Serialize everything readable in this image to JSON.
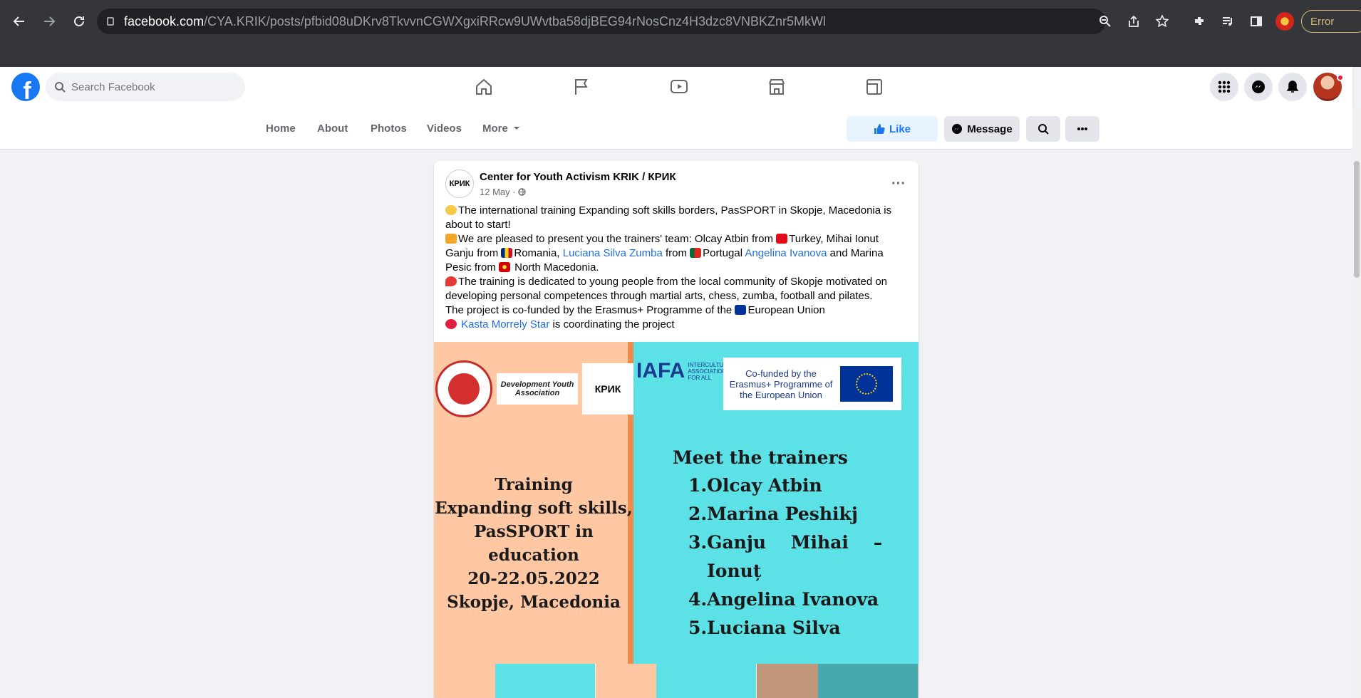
{
  "browser": {
    "url_host": "facebook.com",
    "url_path": "/CYA.KRIK/posts/pfbid08uDKrv8TkvvnCGWXgxiRRcw9UWvtba58djBEG94rNosCnz4H3dzc8VNBKZnr5MkWl",
    "error_label": "Error"
  },
  "header": {
    "logo_letter": "f",
    "search_placeholder": "Search Facebook"
  },
  "page_nav": {
    "tabs": [
      "Home",
      "About",
      "Photos",
      "Videos",
      "More"
    ],
    "like_label": "Like",
    "message_label": "Message"
  },
  "post": {
    "author": "Center for Youth Activism KRIK / КРИК",
    "avatar_text": "КРИК",
    "date": "12 May · ",
    "line1": "The international training Expanding soft skills borders, PasSPORT in Skopje, Macedonia is about to start!",
    "line2_a": "We are pleased to present you the trainers' team: Olcay Atbin from ",
    "line2_b": "Turkey, Mihai Ionut Ganju from ",
    "line2_c": "Romania, ",
    "link1": "Luciana Silva Zumba",
    "line2_d": " from ",
    "line2_e": "Portugal ",
    "link2": "Angelina Ivanova",
    "line2_f": " and Marina Pesic from ",
    "line2_g": " North Macedonia.",
    "line3": "The training is dedicated to young people from the local community of Skopje motivated on developing personal competences through martial arts, chess, zumba, football and pilates.",
    "line4": "The project is co-funded by the Erasmus+ Programme of the ",
    "line4_b": "European Union",
    "link3": "Kasta Morrely Star",
    "line5": " is coordinating the project"
  },
  "image": {
    "logo_dev": "Development Youth Association",
    "logo_iafa": "IAFA",
    "logo_iafa_sub": "INTERCULTURAL ASSOCIATION FOR ALL",
    "eu_text": "Co-funded by the Erasmus+ Programme of the European Union",
    "training_title": [
      "Training",
      "Expanding soft skills,",
      "PasSPORT in education",
      "20-22.05.2022",
      "Skopje, Macedonia"
    ],
    "meet_title": "Meet the trainers",
    "trainers": [
      "1.Olcay Atbin",
      "2.Marina Peshikj",
      "3.Ganju    Mihai    –",
      "   Ionuț",
      "4.Angelina Ivanova",
      "5.Luciana Silva"
    ]
  },
  "colors": {
    "fb_blue": "#1877f2",
    "link": "#216fdb",
    "peach": "#ffc8a2",
    "cyan": "#5ce1e6"
  }
}
